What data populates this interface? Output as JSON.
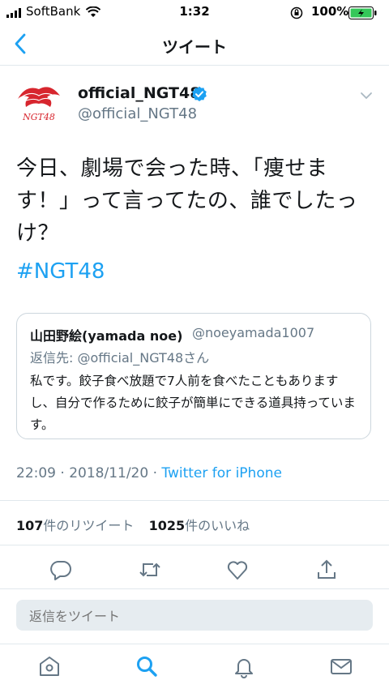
{
  "status_bar": {
    "carrier": "SoftBank",
    "time": "1:32",
    "battery": "100%"
  },
  "nav": {
    "title": "ツイート",
    "back_icon": "chevron-left-icon"
  },
  "tweet": {
    "display_name": "official_NGT48",
    "handle": "@official_NGT48",
    "text": "今日、劇場で会った時、「痩せます！」って言ってたの、誰でしたっけ？",
    "hashtag": "#NGT48",
    "timestamp": "22:09 · 2018/11/20 · ",
    "source": "Twitter for iPhone",
    "avatar_text": "NGT48"
  },
  "quote": {
    "display_name": "山田野絵(yamada noe)",
    "handle": "@noeyamada1007",
    "reply_to": "返信先: @official_NGT48さん",
    "text": "私です。餃子食べ放題で7人前を食べたこともありますし、自分で作るために餃子が簡単にできる道具持っています。"
  },
  "stats": {
    "retweets_count": "107",
    "retweets_label": "件のリツイート",
    "likes_count": "1025",
    "likes_label": "件のいいね"
  },
  "reply": {
    "placeholder": "返信をツイート"
  },
  "colors": {
    "accent": "#1da1f2",
    "secondary_text": "#657786",
    "divider": "#e1e8ed"
  }
}
